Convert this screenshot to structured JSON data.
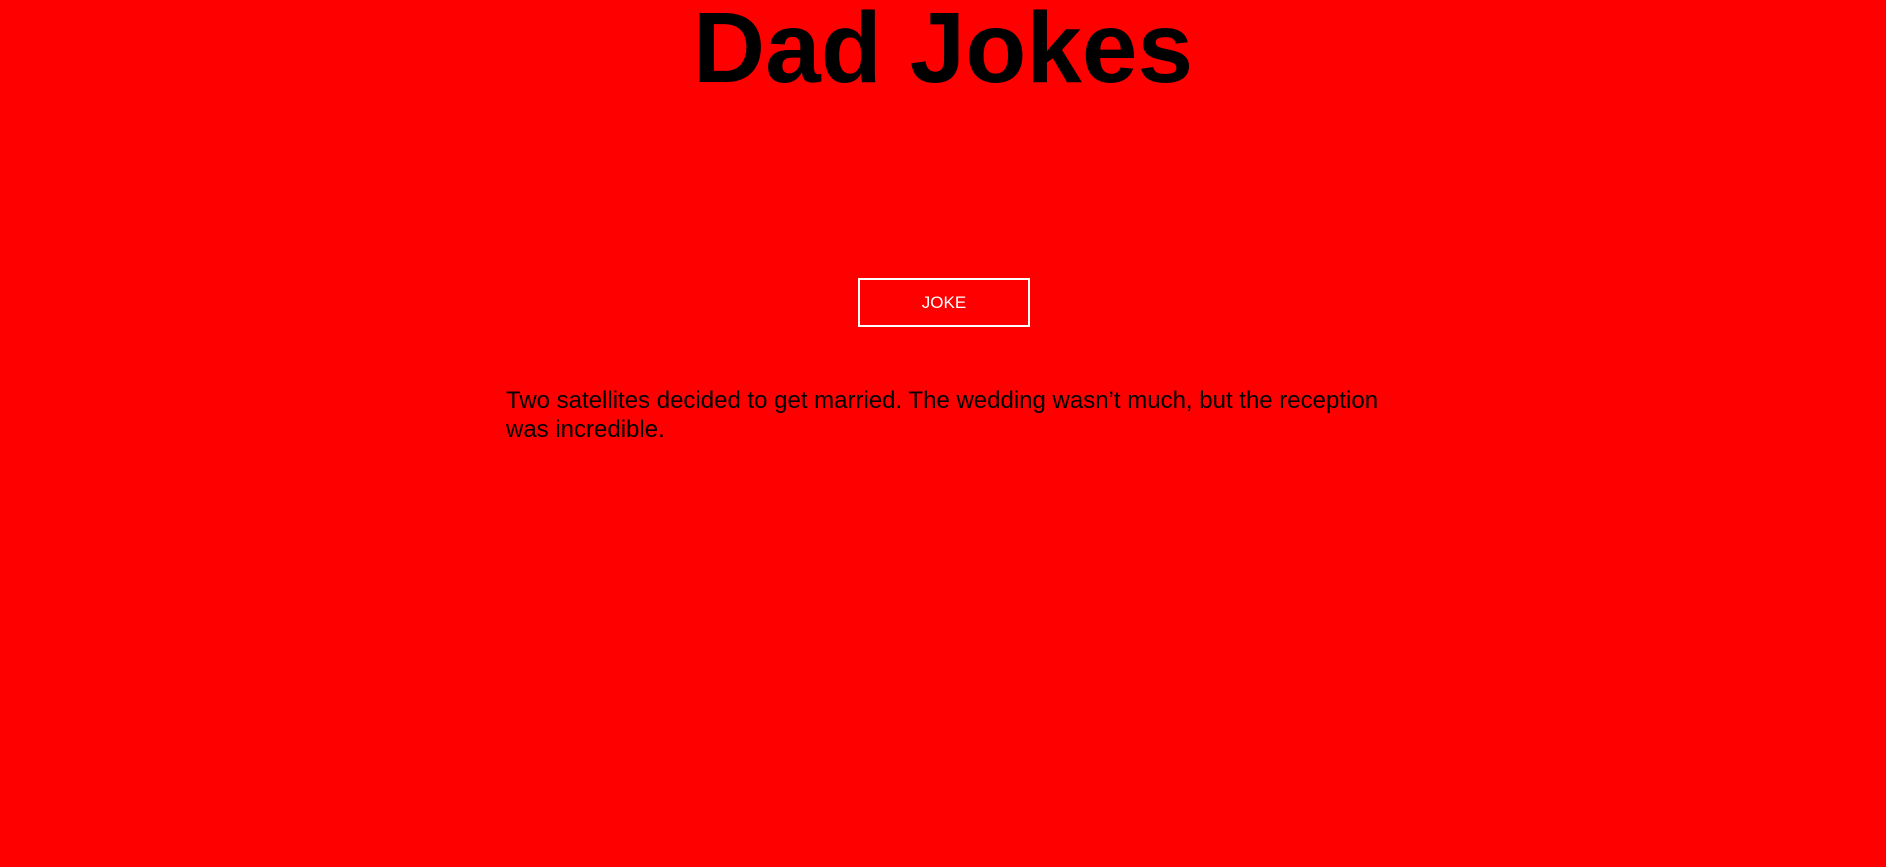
{
  "page": {
    "title": "Dad Jokes",
    "background_color": "#ff0000"
  },
  "controls": {
    "joke_button_label": "JOKE",
    "joke_button_border_color": "#ffffff"
  },
  "joke": {
    "text": "Two satellites decided to get married. The wedding wasn’t much, but the reception was incredible."
  }
}
